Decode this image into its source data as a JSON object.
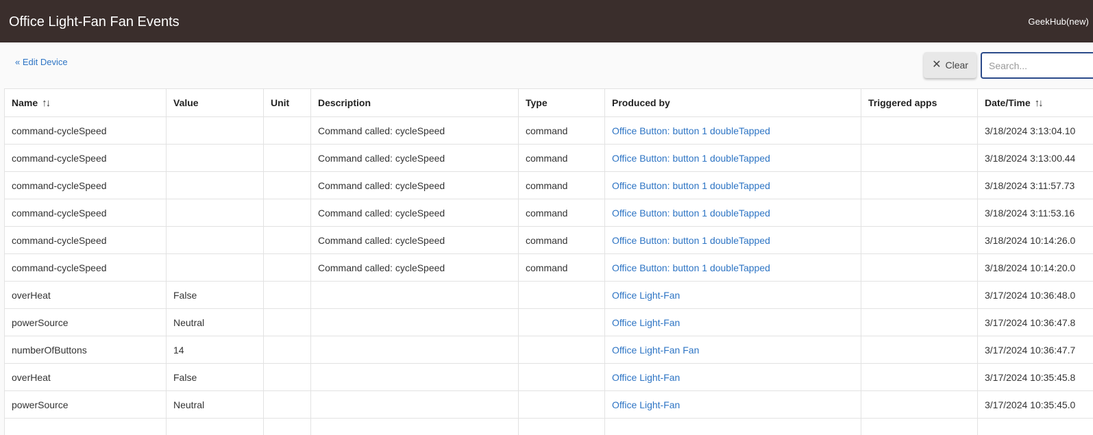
{
  "header": {
    "title": "Office Light-Fan Fan Events",
    "hub_name": "GeekHub(new)"
  },
  "toolbar": {
    "edit_link": "« Edit Device",
    "clear_label": "Clear",
    "search_placeholder": "Search...",
    "search_value": ""
  },
  "icons": {
    "clear": "close-icon",
    "sort": "sort-icon"
  },
  "colors": {
    "topbar": "#3a2e2c",
    "link": "#2d74c4",
    "search_border": "#2b4a8a"
  },
  "table": {
    "columns": [
      {
        "label": "Name",
        "sortable": true
      },
      {
        "label": "Value",
        "sortable": false
      },
      {
        "label": "Unit",
        "sortable": false
      },
      {
        "label": "Description",
        "sortable": false
      },
      {
        "label": "Type",
        "sortable": false
      },
      {
        "label": "Produced by",
        "sortable": false
      },
      {
        "label": "Triggered apps",
        "sortable": false
      },
      {
        "label": "Date/Time",
        "sortable": true
      }
    ],
    "rows": [
      {
        "name": "command-cycleSpeed",
        "value": "",
        "unit": "",
        "description": "Command called: cycleSpeed",
        "type": "command",
        "produced_by": "Office Button: button 1 doubleTapped",
        "triggered_apps": "",
        "datetime": "3/18/2024 3:13:04.10"
      },
      {
        "name": "command-cycleSpeed",
        "value": "",
        "unit": "",
        "description": "Command called: cycleSpeed",
        "type": "command",
        "produced_by": "Office Button: button 1 doubleTapped",
        "triggered_apps": "",
        "datetime": "3/18/2024 3:13:00.44"
      },
      {
        "name": "command-cycleSpeed",
        "value": "",
        "unit": "",
        "description": "Command called: cycleSpeed",
        "type": "command",
        "produced_by": "Office Button: button 1 doubleTapped",
        "triggered_apps": "",
        "datetime": "3/18/2024 3:11:57.73"
      },
      {
        "name": "command-cycleSpeed",
        "value": "",
        "unit": "",
        "description": "Command called: cycleSpeed",
        "type": "command",
        "produced_by": "Office Button: button 1 doubleTapped",
        "triggered_apps": "",
        "datetime": "3/18/2024 3:11:53.16"
      },
      {
        "name": "command-cycleSpeed",
        "value": "",
        "unit": "",
        "description": "Command called: cycleSpeed",
        "type": "command",
        "produced_by": "Office Button: button 1 doubleTapped",
        "triggered_apps": "",
        "datetime": "3/18/2024 10:14:26.0"
      },
      {
        "name": "command-cycleSpeed",
        "value": "",
        "unit": "",
        "description": "Command called: cycleSpeed",
        "type": "command",
        "produced_by": "Office Button: button 1 doubleTapped",
        "triggered_apps": "",
        "datetime": "3/18/2024 10:14:20.0"
      },
      {
        "name": "overHeat",
        "value": "False",
        "unit": "",
        "description": "",
        "type": "",
        "produced_by": "Office Light-Fan",
        "triggered_apps": "",
        "datetime": "3/17/2024 10:36:48.0"
      },
      {
        "name": "powerSource",
        "value": "Neutral",
        "unit": "",
        "description": "",
        "type": "",
        "produced_by": "Office Light-Fan",
        "triggered_apps": "",
        "datetime": "3/17/2024 10:36:47.8"
      },
      {
        "name": "numberOfButtons",
        "value": "14",
        "unit": "",
        "description": "",
        "type": "",
        "produced_by": "Office Light-Fan Fan",
        "triggered_apps": "",
        "datetime": "3/17/2024 10:36:47.7"
      },
      {
        "name": "overHeat",
        "value": "False",
        "unit": "",
        "description": "",
        "type": "",
        "produced_by": "Office Light-Fan",
        "triggered_apps": "",
        "datetime": "3/17/2024 10:35:45.8"
      },
      {
        "name": "powerSource",
        "value": "Neutral",
        "unit": "",
        "description": "",
        "type": "",
        "produced_by": "Office Light-Fan",
        "triggered_apps": "",
        "datetime": "3/17/2024 10:35:45.0"
      },
      {
        "name": "",
        "value": "",
        "unit": "",
        "description": "",
        "type": "",
        "produced_by": "",
        "triggered_apps": "",
        "datetime": ""
      }
    ]
  }
}
